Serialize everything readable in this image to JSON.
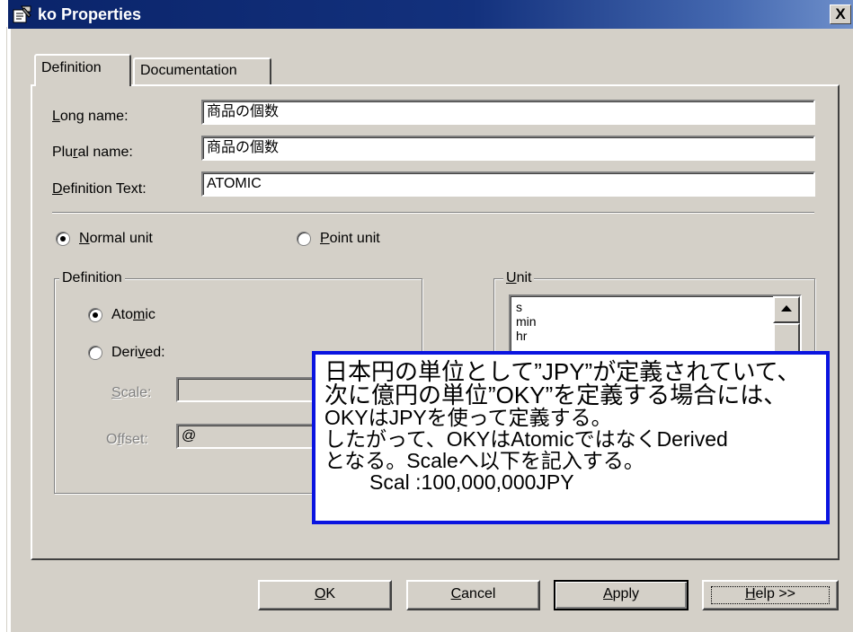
{
  "window": {
    "title": "ko Properties",
    "close_label": "X"
  },
  "tabs": [
    {
      "label": "Definition",
      "selected": true
    },
    {
      "label": "Documentation",
      "selected": false
    }
  ],
  "fields": {
    "long_name": {
      "label_pre": "",
      "label_u": "L",
      "label_post": "ong name:",
      "value": "商品の個数"
    },
    "plural_name": {
      "label_pre": "Plu",
      "label_u": "r",
      "label_post": "al name:",
      "value": "商品の個数"
    },
    "definition_text": {
      "label_pre": "",
      "label_u": "D",
      "label_post": "efinition Text:",
      "value": "ATOMIC"
    }
  },
  "unit_type": {
    "normal": {
      "label_u": "N",
      "label_post": "ormal unit",
      "checked": true
    },
    "point": {
      "label_u": "P",
      "label_post": "oint unit",
      "checked": false
    }
  },
  "definition_group": {
    "title": "Definition",
    "atomic": {
      "label_pre": "Ato",
      "label_u": "m",
      "label_post": "ic",
      "checked": true
    },
    "derived": {
      "label_pre": "Deri",
      "label_u": "v",
      "label_post": "ed:",
      "checked": false
    },
    "scale": {
      "label_u": "S",
      "label_post": "cale:",
      "value": ""
    },
    "offset": {
      "label_pre": "O",
      "label_u": "f",
      "label_post": "fset:",
      "value": "@"
    }
  },
  "unit_group": {
    "title_u": "U",
    "title_post": "nit",
    "items": [
      "s",
      "min",
      "hr"
    ]
  },
  "annotation": {
    "lines": [
      "日本円の単位として”JPY”が定義されていて、",
      "次に億円の単位”OKY”を定義する場合には、",
      "OKYはJPYを使って定義する。",
      "したがって、OKYはAtomicではなくDerived",
      "となる。Scaleへ以下を記入する。",
      "Scal :100,000,000JPY"
    ],
    "border_color": "#0a14e0"
  },
  "buttons": {
    "ok": {
      "label_u": "O",
      "label_post": "K"
    },
    "cancel": {
      "label_u": "C",
      "label_post": "ancel"
    },
    "apply": {
      "label_u": "A",
      "label_post": "pply"
    },
    "help": {
      "label_u": "H",
      "label_post": "elp >>"
    }
  },
  "colors": {
    "title_bar": "#0a246a",
    "face": "#d4d0c8"
  }
}
